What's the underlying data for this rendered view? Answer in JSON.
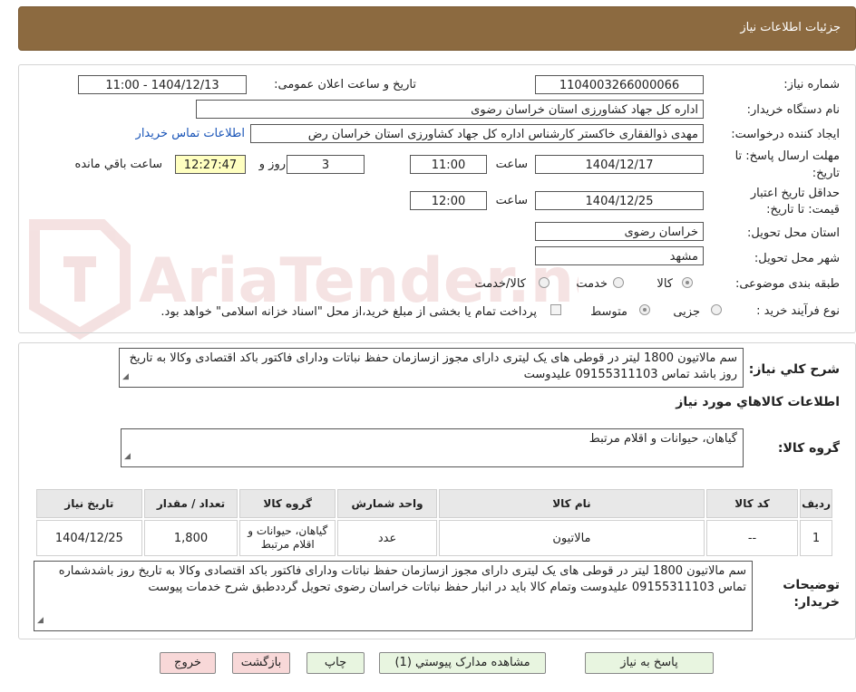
{
  "header": {
    "title": "جزئیات اطلاعات نیاز"
  },
  "watermark": {
    "text": "AriaTender.neT"
  },
  "fields": {
    "need_number": {
      "label": "شماره نیاز:",
      "value": "1104003266000066"
    },
    "announce_datetime": {
      "label": "تاریخ و ساعت اعلان عمومی:",
      "value": "1404/12/13 - 11:00"
    },
    "buyer_org": {
      "label": "نام دستگاه خریدار:",
      "value": "اداره کل جهاد کشاورزی استان خراسان رضوی"
    },
    "requester": {
      "label": "ایجاد کننده درخواست:",
      "value": "مهدی ذوالفقاری خاکستر کارشناس  اداره کل جهاد کشاورزی استان خراسان رض",
      "contact_link": "اطلاعات تماس خریدار"
    },
    "deadline": {
      "label_line1": "مهلت ارسال پاسخ: تا",
      "label_line2": "تاریخ:",
      "date": "1404/12/17",
      "time_label": "ساعت",
      "time": "11:00",
      "days": "3",
      "days_label": "روز و",
      "remaining": "12:27:47",
      "remaining_label": "ساعت باقي مانده"
    },
    "validity": {
      "label_line1": "حداقل تاریخ اعتبار",
      "label_line2": "قیمت: تا تاریخ:",
      "date": "1404/12/25",
      "time_label": "ساعت",
      "time": "12:00"
    },
    "province": {
      "label": "استان محل تحویل:",
      "value": "خراسان رضوی"
    },
    "city": {
      "label": "شهر محل تحویل:",
      "value": "مشهد"
    },
    "category": {
      "label": "طبقه بندی موضوعی:",
      "options": [
        "کالا",
        "خدمت",
        "کالا/خدمت"
      ],
      "selected": "کالا"
    },
    "process": {
      "label": "نوع فرآیند خرید :",
      "options": [
        "جزیی",
        "متوسط"
      ],
      "selected": "متوسط",
      "note": "پرداخت تمام یا بخشی از مبلغ خرید،از محل \"اسناد خزانه اسلامی\" خواهد بود."
    }
  },
  "summary": {
    "label": "شرح کلي نیاز:",
    "text": "سم مالاتیون 1800 لیتر در قوطی های یک لیتری دارای مجوز ازسازمان حفظ نباتات ودارای فاکتور باکد اقتصادی وکالا به تاریخ روز باشد تماس 09155311103 علیدوست"
  },
  "goods": {
    "section_title": "اطلاعات کالاهاي مورد نیاز",
    "group_label": "گروه کالا:",
    "group_value": "گیاهان، حیوانات و اقلام مرتبط",
    "columns": [
      "ردیف",
      "کد کالا",
      "نام کالا",
      "واحد شمارش",
      "گروه کالا",
      "تعداد / مقدار",
      "تاریخ نیاز"
    ],
    "rows": [
      {
        "row": "1",
        "code": "--",
        "name": "مالاتیون",
        "unit": "عدد",
        "group": "گیاهان، حیوانات و اقلام مرتبط",
        "qty": "1,800",
        "date": "1404/12/25"
      }
    ]
  },
  "buyer_notes": {
    "label_line1": "توضیحات",
    "label_line2": "خریدار:",
    "text": "سم مالاتیون 1800 لیتر در قوطی های یک لیتری دارای مجوز ازسازمان حفظ نباتات ودارای فاکتور باکد اقتصادی وکالا به تاریخ روز باشدشماره تماس 09155311103 علیدوست وتمام کالا باید در انبار حفظ نباتات خراسان رضوی تحویل گرددطبق شرح خدمات پیوست"
  },
  "buttons": {
    "reply": "پاسخ به نیاز",
    "attachments": "مشاهده مدارک پیوستي (1)",
    "print": "چاپ",
    "back": "بازگشت",
    "exit": "خروج"
  }
}
